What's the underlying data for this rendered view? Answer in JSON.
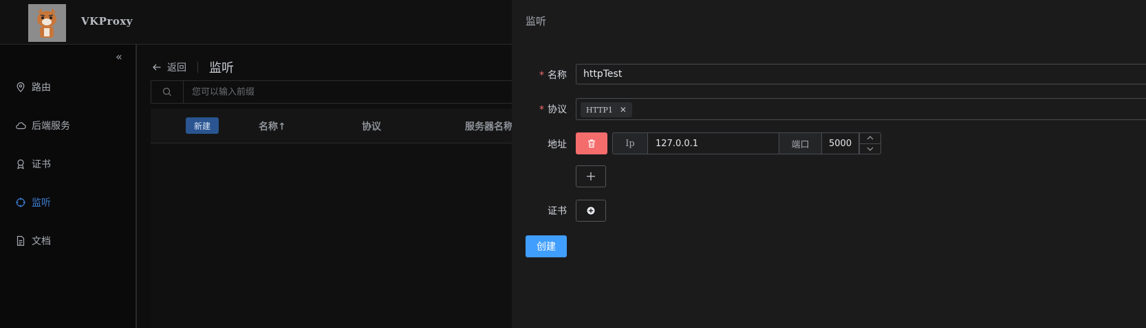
{
  "app": {
    "brand": "VKProxy"
  },
  "sidebar": {
    "items": [
      {
        "label": "路由",
        "icon": "location-icon"
      },
      {
        "label": "后端服务",
        "icon": "cloud-icon"
      },
      {
        "label": "证书",
        "icon": "certificate-icon"
      },
      {
        "label": "监听",
        "icon": "aim-icon",
        "active": true
      },
      {
        "label": "文档",
        "icon": "document-icon"
      }
    ]
  },
  "page": {
    "back_label": "返回",
    "title": "监听",
    "search_placeholder": "您可以输入前缀",
    "new_button": "新建",
    "columns": [
      "名称↑",
      "协议",
      "服务器名称"
    ]
  },
  "drawer": {
    "title": "监听",
    "name_label": "名称",
    "name_value": "httpTest",
    "protocol_label": "协议",
    "protocol_tag": "HTTP1",
    "address_label": "地址",
    "ip_addon": "Ip",
    "ip_value": "127.0.0.1",
    "port_addon": "端口",
    "port_value": "5000",
    "cert_label": "证书",
    "create_button": "创建"
  },
  "colors": {
    "accent": "#409eff",
    "danger": "#f56c6c",
    "active_nav": "#3f7fd6"
  }
}
